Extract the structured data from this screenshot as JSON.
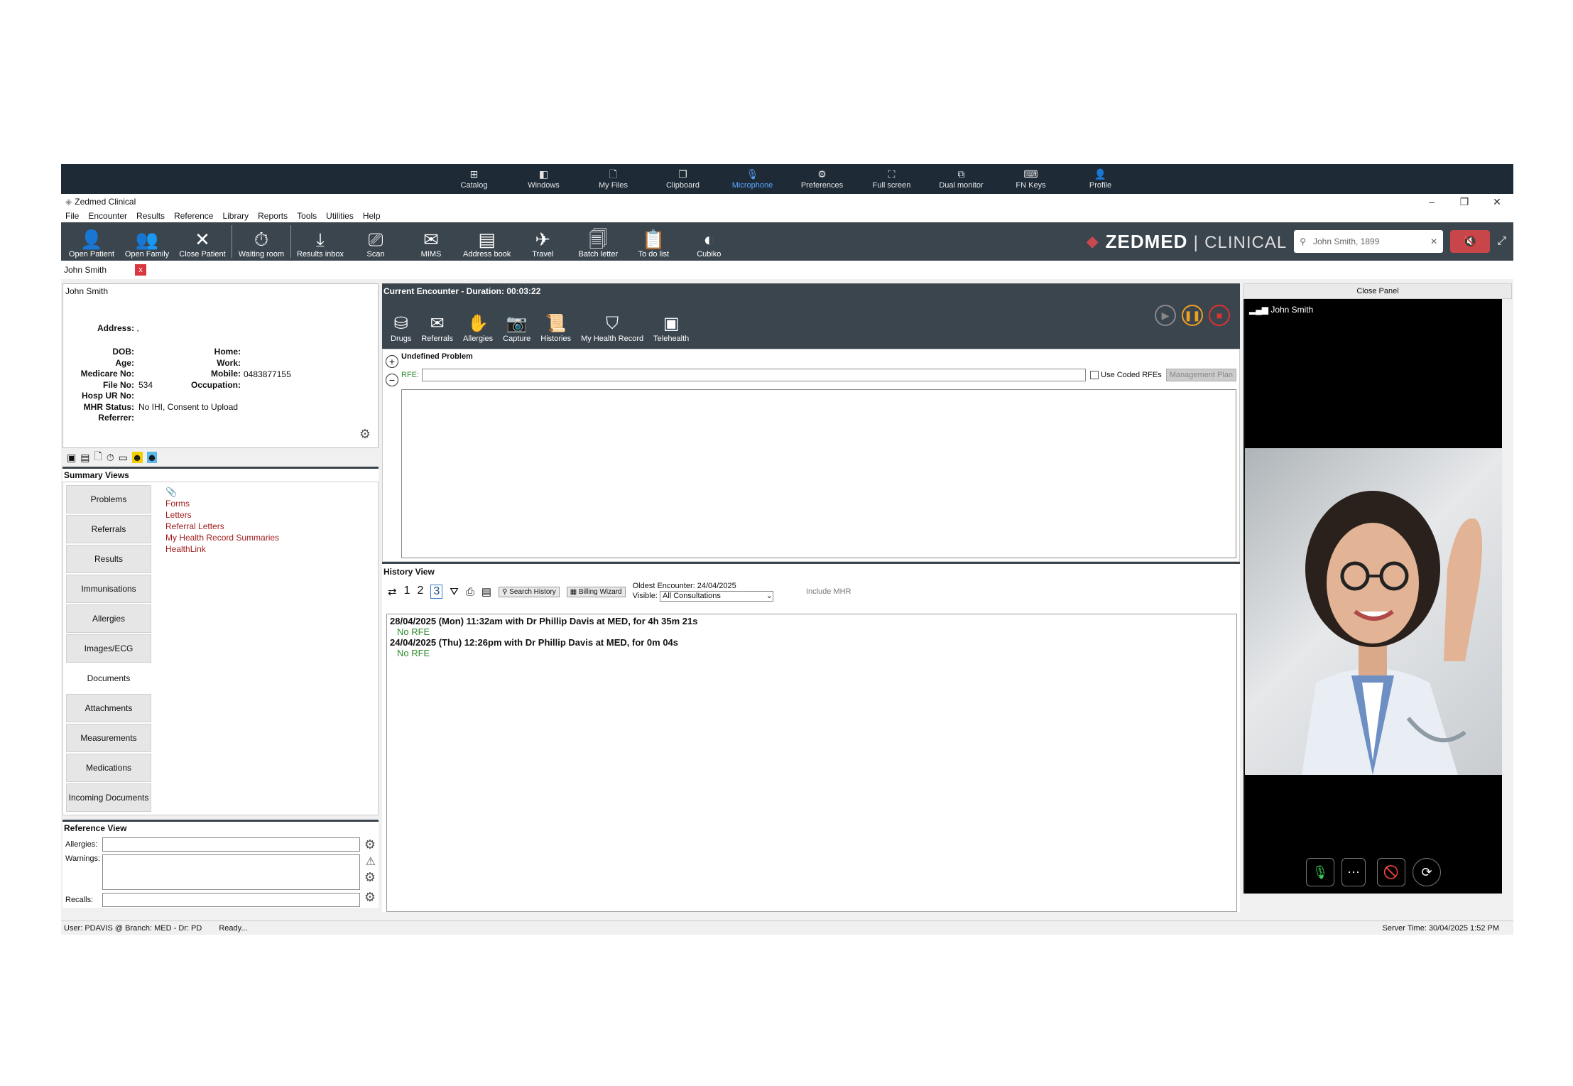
{
  "remote": {
    "items": [
      {
        "label": "Catalog",
        "icon": "⊞"
      },
      {
        "label": "Windows",
        "icon": "◧"
      },
      {
        "label": "My Files",
        "icon": "🗋"
      },
      {
        "label": "Clipboard",
        "icon": "❐"
      },
      {
        "label": "Microphone",
        "icon": "🎙"
      },
      {
        "label": "Preferences",
        "icon": "⚙"
      },
      {
        "label": "Full screen",
        "icon": "⛶"
      },
      {
        "label": "Dual monitor",
        "icon": "⧉"
      },
      {
        "label": "FN Keys",
        "icon": "⌨"
      },
      {
        "label": "Profile",
        "icon": "👤"
      }
    ],
    "active": "Microphone"
  },
  "window": {
    "title": "Zedmed Clinical",
    "minimize": "–",
    "restore": "❐",
    "close": "✕"
  },
  "menu": [
    "File",
    "Encounter",
    "Results",
    "Reference",
    "Library",
    "Reports",
    "Tools",
    "Utilities",
    "Help"
  ],
  "toolbar": {
    "items": [
      {
        "label": "Open Patient",
        "icon": "👤"
      },
      {
        "label": "Open Family",
        "icon": "👥"
      },
      {
        "label": "Close Patient",
        "icon": "✕"
      },
      {
        "label": "Waiting room",
        "icon": "⏱"
      },
      {
        "label": "Results inbox",
        "icon": "⤓"
      },
      {
        "label": "Scan",
        "icon": "⎚"
      },
      {
        "label": "MIMS",
        "icon": "✉"
      },
      {
        "label": "Address book",
        "icon": "▤"
      },
      {
        "label": "Travel",
        "icon": "✈"
      },
      {
        "label": "Batch letter",
        "icon": "🗐"
      },
      {
        "label": "To do list",
        "icon": "📋"
      },
      {
        "label": "Cubiko",
        "icon": "◐"
      }
    ],
    "brand": "ZEDMED",
    "brand_sub": "CLINICAL",
    "search_value": "John Smith, 1899"
  },
  "patient_tab": {
    "name": "John Smith",
    "close": "x"
  },
  "patient": {
    "name": "John Smith",
    "address_label": "Address:",
    "address": ",",
    "dob_label": "DOB:",
    "age_label": "Age:",
    "medicare_label": "Medicare No:",
    "file_label": "File No:",
    "file": "534",
    "hosp_label": "Hosp UR No:",
    "mhr_label": "MHR Status:",
    "mhr": "No IHI, Consent to Upload",
    "referrer_label": "Referrer:",
    "home_label": "Home:",
    "work_label": "Work:",
    "mobile_label": "Mobile:",
    "mobile": "0483877155",
    "occupation_label": "Occupation:"
  },
  "summary": {
    "title": "Summary Views",
    "tabs": [
      "Problems",
      "Referrals",
      "Results",
      "Immunisations",
      "Allergies",
      "Images/ECG",
      "Documents",
      "Attachments",
      "Measurements",
      "Medications",
      "Incoming Documents"
    ],
    "selected": "Documents",
    "docs": [
      "Forms",
      "Letters",
      "Referral Letters",
      "My Health Record Summaries",
      "HealthLink"
    ]
  },
  "reference": {
    "title": "Reference View",
    "allergies": "Allergies:",
    "warnings": "Warnings:",
    "recalls": "Recalls:"
  },
  "encounter": {
    "header": "Current Encounter - Duration: 00:03:22",
    "tools": [
      {
        "label": "Drugs",
        "icon": "⛁"
      },
      {
        "label": "Referrals",
        "icon": "✉"
      },
      {
        "label": "Allergies",
        "icon": "✋"
      },
      {
        "label": "Capture",
        "icon": "📷"
      },
      {
        "label": "Histories",
        "icon": "📜"
      },
      {
        "label": "My Health Record",
        "icon": "⛉"
      },
      {
        "label": "Telehealth",
        "icon": "▣"
      }
    ],
    "problem_tab": "Undefined Problem",
    "rfe_label": "RFE:",
    "coded": "Use Coded RFEs",
    "mgmt": "Management Plan"
  },
  "history": {
    "title": "History View",
    "pages": [
      "1",
      "2",
      "3"
    ],
    "search": "Search History",
    "billing": "Billing Wizard",
    "oldest": "Oldest Encounter: 24/04/2025",
    "visible_label": "Visible:",
    "visible": "All Consultations",
    "include_mhr": "Include MHR",
    "entries": [
      {
        "text": "28/04/2025 (Mon) 11:32am with Dr Phillip Davis at MED, for 4h 35m 21s",
        "rfe": "No RFE"
      },
      {
        "text": "24/04/2025 (Thu) 12:26pm with Dr Phillip Davis at MED, for 0m 04s",
        "rfe": "No RFE"
      }
    ]
  },
  "video": {
    "close_panel": "Close Panel",
    "name": "John Smith",
    "more": "⋯"
  },
  "status": {
    "user": "User: PDAVIS @ Branch: MED - Dr: PD",
    "ready": "Ready...",
    "server": "Server Time: 30/04/2025 1:52 PM"
  }
}
